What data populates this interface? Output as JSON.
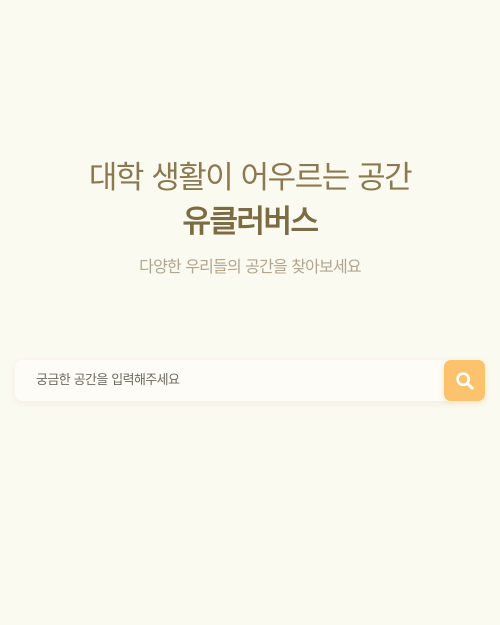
{
  "hero": {
    "title_line": "대학 생활이 어우르는 공간",
    "brand_name": "유클러버스",
    "subtitle": "다양한 우리들의 공간을 찾아보세요"
  },
  "search": {
    "placeholder": "궁금한 공간을 입력해주세요",
    "value": "",
    "button_icon": "search-icon"
  },
  "colors": {
    "background": "#fbfaf1",
    "title": "#8a7a52",
    "brand": "#7c6c43",
    "subtitle": "#b1a58e",
    "accent": "#fdc26c"
  }
}
